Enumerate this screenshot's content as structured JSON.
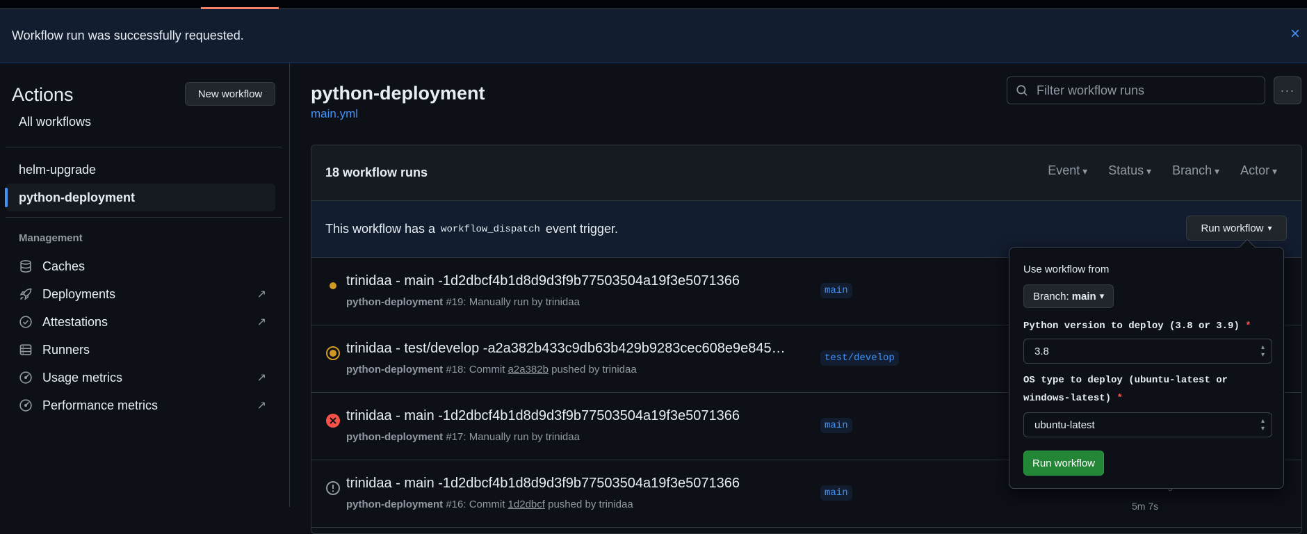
{
  "flash": {
    "message": "Workflow run was successfully requested.",
    "close": "×"
  },
  "sidebar": {
    "title": "Actions",
    "new_workflow": "New workflow",
    "all_workflows": "All workflows",
    "workflows": [
      {
        "label": "helm-upgrade"
      },
      {
        "label": "python-deployment",
        "active": true
      }
    ],
    "management_title": "Management",
    "management": [
      {
        "label": "Caches",
        "icon": "database-icon",
        "external": false
      },
      {
        "label": "Deployments",
        "icon": "rocket-icon",
        "external": true
      },
      {
        "label": "Attestations",
        "icon": "verified-icon",
        "external": true
      },
      {
        "label": "Runners",
        "icon": "server-icon",
        "external": false
      },
      {
        "label": "Usage metrics",
        "icon": "meter-icon",
        "external": true
      },
      {
        "label": "Performance metrics",
        "icon": "meter-icon",
        "external": true
      }
    ]
  },
  "main": {
    "title": "python-deployment",
    "file": "main.yml",
    "filter_placeholder": "Filter workflow runs",
    "more": "···",
    "runs_count": "18 workflow runs",
    "filters": [
      "Event",
      "Status",
      "Branch",
      "Actor"
    ],
    "dispatch": {
      "prefix": "This workflow has a",
      "code": "workflow_dispatch",
      "suffix": "event trigger.",
      "button": "Run workflow"
    },
    "runs": [
      {
        "status": "queued",
        "title": "trinidaa - main -1d2dbcf4b1d8d9d3f9b77503504a19f3e5071366",
        "workflow": "python-deployment",
        "sub": "#19: Manually run by trinidaa",
        "commit": "",
        "sub_after": "",
        "branch": "main"
      },
      {
        "status": "in-progress",
        "title": "trinidaa - test/develop -a2a382b433c9db63b429b9283cec608e9e845…",
        "workflow": "python-deployment",
        "sub": "#18: Commit",
        "commit": "a2a382b",
        "sub_after": "pushed by trinidaa",
        "branch": "test/develop"
      },
      {
        "status": "failed",
        "title": "trinidaa - main -1d2dbcf4b1d8d9d3f9b77503504a19f3e5071366",
        "workflow": "python-deployment",
        "sub": "#17: Manually run by trinidaa",
        "commit": "",
        "sub_after": "",
        "branch": "main"
      },
      {
        "status": "cancelled",
        "title": "trinidaa - main -1d2dbcf4b1d8d9d3f9b77503504a19f3e5071366",
        "workflow": "python-deployment",
        "sub": "#16: Commit",
        "commit": "1d2dbcf",
        "sub_after": "pushed by trinidaa",
        "branch": "main"
      }
    ],
    "peek": {
      "time": "1 hour ago",
      "duration": "5m 7s"
    }
  },
  "popover": {
    "use_from": "Use workflow from",
    "branch_label": "Branch:",
    "branch_value": "main",
    "python_label": "Python version to deploy (3.8 or 3.9)",
    "python_value": "3.8",
    "os_label": "OS type to deploy (ubuntu-latest or windows-latest)",
    "os_value": "ubuntu-latest",
    "required": "*",
    "submit": "Run workflow"
  }
}
